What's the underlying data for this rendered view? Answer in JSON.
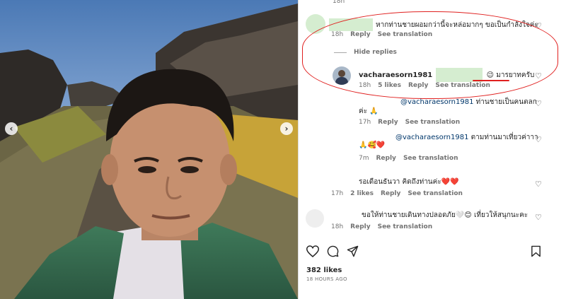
{
  "post": {
    "top_time": "18h",
    "likes": "382 likes",
    "posted_ago": "18 HOURS AGO"
  },
  "comments": [
    {
      "text": "หากท่านชายผอมกว่านี้จะหล่อมากๆ ขอเป็นกำลังใจค่ะ",
      "time": "18h",
      "reply": "Reply",
      "translate": "See translation"
    }
  ],
  "hide_replies": "Hide replies",
  "replies": [
    {
      "username": "vacharaesorn1981",
      "text": "มารยาทครับ",
      "emoji": "😉",
      "time": "18h",
      "likes": "5 likes",
      "reply": "Reply",
      "translate": "See translation"
    },
    {
      "mention": "@vacharaesorn1981",
      "text_line1": "ท่านชายเป็นคนตลก",
      "text_line2": "ค่ะ 🙏",
      "time": "17h",
      "reply": "Reply",
      "translate": "See translation"
    },
    {
      "mention": "@vacharaesorn1981",
      "text_line1": "ตามท่านมาเที่ยวค่าาา",
      "text_line2": "🙏🥰❤️",
      "time": "7m",
      "reply": "Reply",
      "translate": "See translation"
    }
  ],
  "more_comments": [
    {
      "text": "รอเดือนธันวา คิดถึงท่านค่ะ❤️❤️",
      "time": "17h",
      "likes": "2 likes",
      "reply": "Reply",
      "translate": "See translation"
    },
    {
      "text": "ขอให้ท่านชายเดินทางปลอดภัย🤍😊 เที่ยวให้สนุกนะคะ",
      "time": "18h",
      "reply": "Reply",
      "translate": "See translation"
    }
  ],
  "icons": {
    "like": "heart-icon",
    "comment": "comment-icon",
    "share": "paper-plane-icon",
    "save": "bookmark-icon",
    "prev": "chevron-left-icon",
    "next": "chevron-right-icon"
  },
  "colors": {
    "annotation_red": "#e0201f",
    "mention_blue": "#00376b",
    "muted_text": "#737373"
  }
}
